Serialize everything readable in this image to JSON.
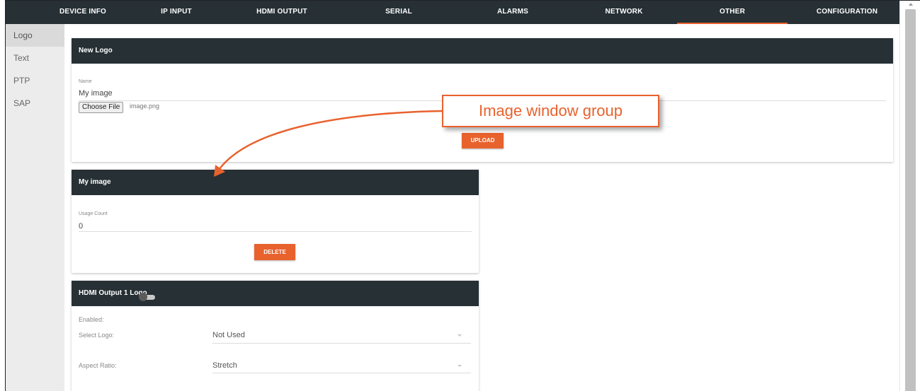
{
  "nav": {
    "tabs": [
      {
        "label": "DEVICE INFO"
      },
      {
        "label": "IP INPUT"
      },
      {
        "label": "HDMI OUTPUT"
      },
      {
        "label": "SERIAL"
      },
      {
        "label": "ALARMS"
      },
      {
        "label": "NETWORK"
      },
      {
        "label": "OTHER"
      },
      {
        "label": "CONFIGURATION"
      }
    ],
    "active_tab": "OTHER"
  },
  "sidebar": {
    "items": [
      {
        "label": "Logo"
      },
      {
        "label": "Text"
      },
      {
        "label": "PTP"
      },
      {
        "label": "SAP"
      }
    ],
    "active_item": "Logo"
  },
  "new_logo": {
    "title": "New Logo",
    "name_label": "Name",
    "name_value": "My image",
    "choose_file_label": "Choose File",
    "file_name": "image.png",
    "upload_label": "UPLOAD"
  },
  "image_card": {
    "title": "My image",
    "usage_label": "Usage Count",
    "usage_value": "0",
    "delete_label": "DELETE"
  },
  "hdmi_logo": {
    "title": "HDMI Output 1 Logo",
    "enabled_label": "Enabled:",
    "enabled": false,
    "select_logo_label": "Select Logo:",
    "select_logo_value": "Not Used",
    "aspect_ratio_label": "Aspect Ratio:",
    "aspect_ratio_value": "Stretch"
  },
  "callout": {
    "text": "Image window group"
  },
  "colors": {
    "header_bg": "#263035",
    "accent": "#e8622d",
    "sidebar_bg": "#ececec"
  }
}
